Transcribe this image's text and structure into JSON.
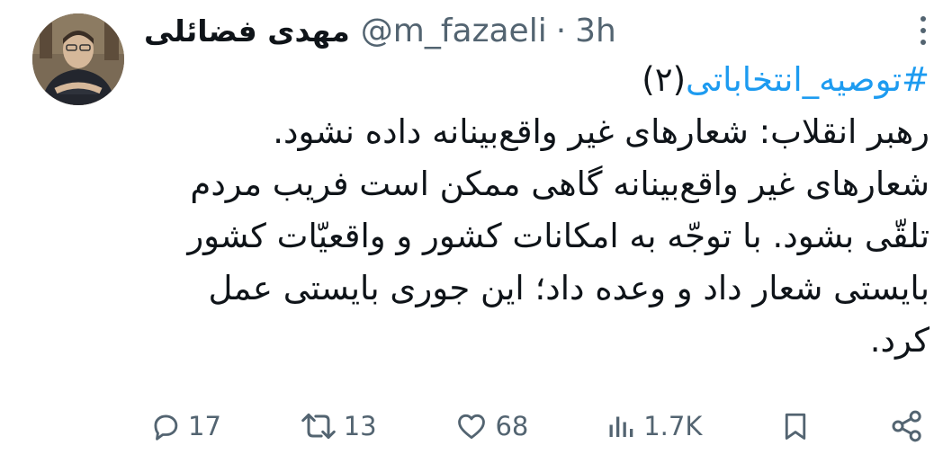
{
  "tweet": {
    "author": {
      "display_name": "مهدی فضائلی",
      "handle": "@m_fazaeli",
      "separator": "·",
      "timestamp": "3h"
    },
    "hashtag": "#توصیه_انتخاباتی",
    "hashtag_suffix": "(۲)",
    "lines": [
      "رهبر انقلاب: شعارهای غیر واقع‌بینانه داده نشود.",
      "شعارهای غیر واقع‌بینانه گاهی ممکن است فریب مردم",
      "تلقّی بشود. با توجّه به امکانات کشور و واقعیّات کشور",
      "بایستی شعار داد و وعده داد؛ این جوری بایستی عمل",
      "کرد."
    ],
    "actions": {
      "replies": "17",
      "retweets": "13",
      "likes": "68",
      "views": "1.7K"
    }
  },
  "icons": {
    "more": "more-dots-icon",
    "reply": "reply-icon",
    "retweet": "retweet-icon",
    "like": "heart-icon",
    "views": "views-icon",
    "bookmark": "bookmark-icon",
    "share": "share-icon"
  },
  "colors": {
    "text": "#0f1419",
    "secondary": "#536471",
    "link": "#1d9bf0"
  }
}
